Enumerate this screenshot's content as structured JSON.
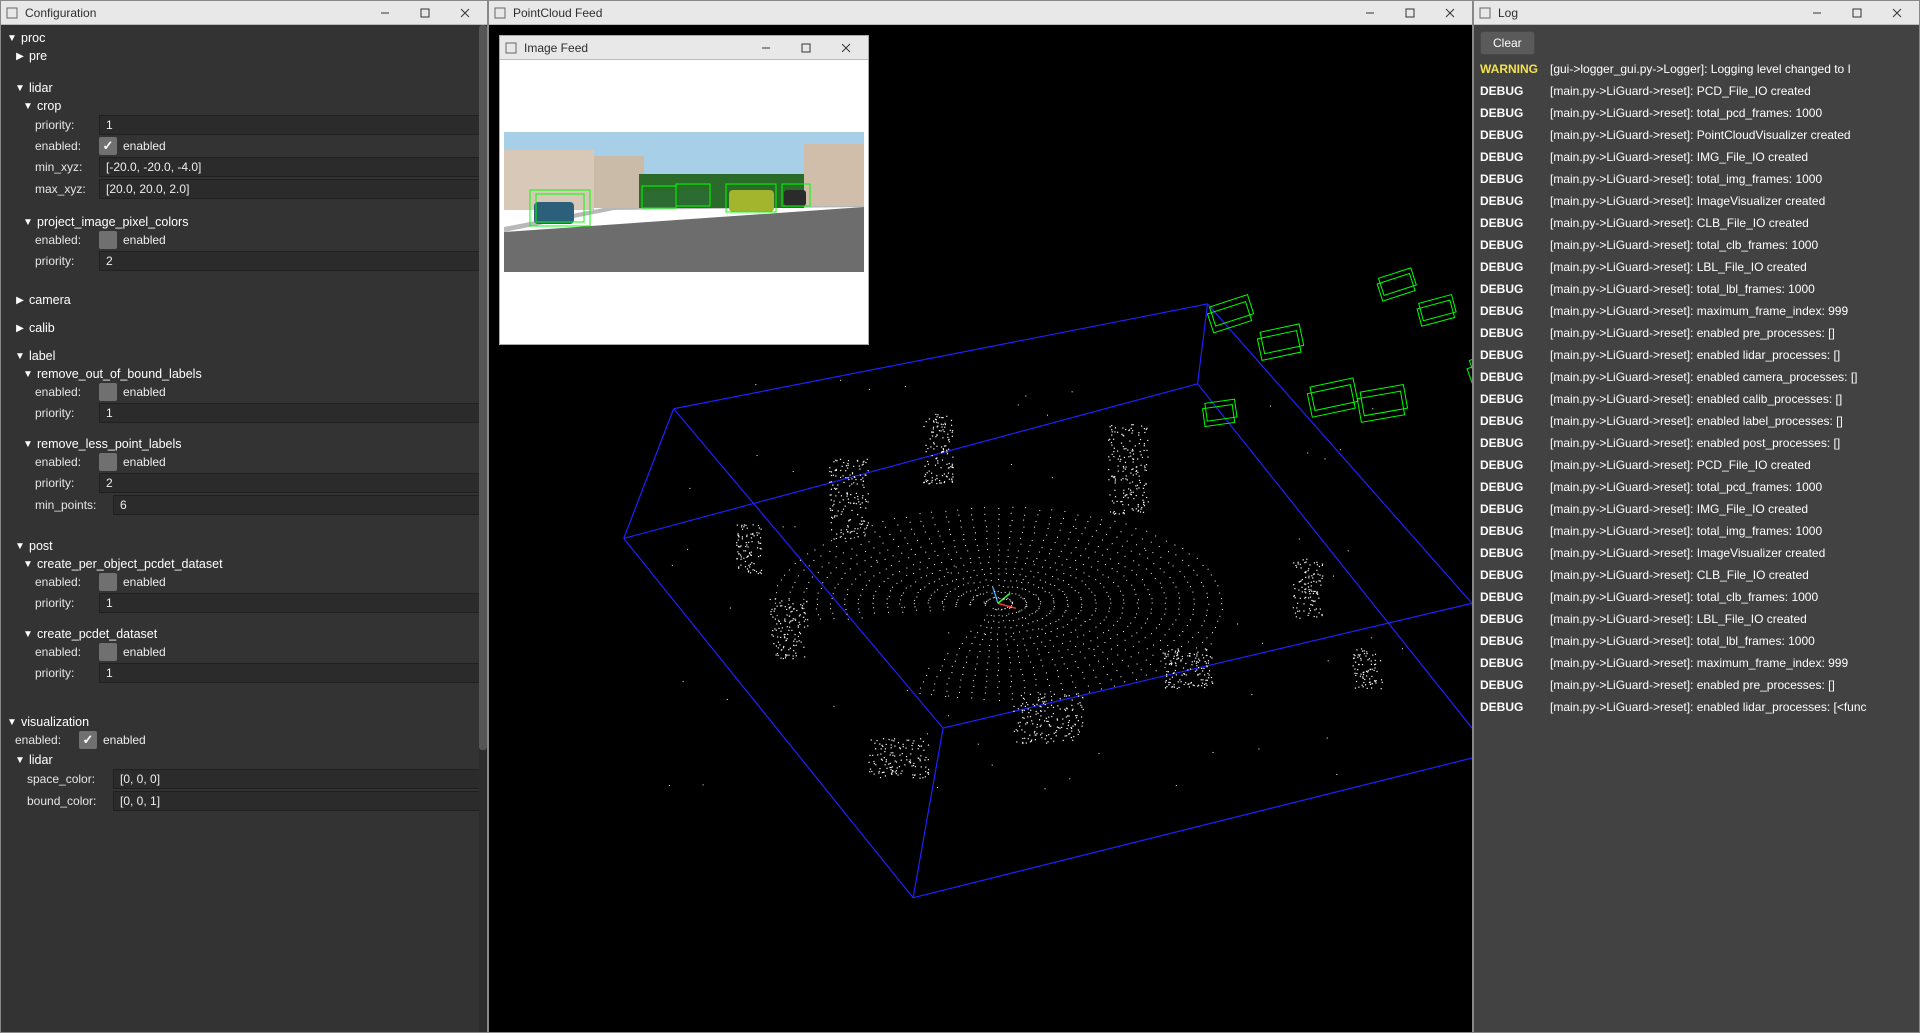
{
  "windows": {
    "config_title": "Configuration",
    "pcd_title": "PointCloud Feed",
    "log_title": "Log",
    "image_feed_title": "Image Feed"
  },
  "config": {
    "sections": {
      "proc": "proc",
      "pre": "pre",
      "lidar": "lidar",
      "crop": "crop",
      "project_image_pixel_colors": "project_image_pixel_colors",
      "camera": "camera",
      "calib": "calib",
      "label": "label",
      "remove_out_of_bound_labels": "remove_out_of_bound_labels",
      "remove_less_point_labels": "remove_less_point_labels",
      "post": "post",
      "create_per_object_pcdet_dataset": "create_per_object_pcdet_dataset",
      "create_pcdet_dataset": "create_pcdet_dataset",
      "visualization": "visualization",
      "viz_lidar": "lidar"
    },
    "labels": {
      "priority": "priority:",
      "enabled": "enabled:",
      "enabled_text": "enabled",
      "min_xyz": "min_xyz:",
      "max_xyz": "max_xyz:",
      "min_points": "min_points:",
      "space_color": "space_color:",
      "bound_color": "bound_color:"
    },
    "values": {
      "crop_priority": "1",
      "crop_enabled": true,
      "crop_min_xyz": "[-20.0, -20.0, -4.0]",
      "crop_max_xyz": "[20.0, 20.0, 2.0]",
      "pipc_enabled": false,
      "pipc_priority": "2",
      "rofb_enabled": false,
      "rofb_priority": "1",
      "rlpl_enabled": false,
      "rlpl_priority": "2",
      "rlpl_min_points": "6",
      "cpopd_enabled": false,
      "cpopd_priority": "1",
      "cpd_enabled": false,
      "cpd_priority": "1",
      "viz_enabled": true,
      "viz_space_color": "[0, 0, 0]",
      "viz_bound_color": "[0, 0, 1]"
    }
  },
  "log": {
    "clear_button": "Clear",
    "entries": [
      {
        "level": "WARNING",
        "msg": "[gui->logger_gui.py->Logger]: Logging level changed to I"
      },
      {
        "level": "DEBUG",
        "msg": "[main.py->LiGuard->reset]: PCD_File_IO created"
      },
      {
        "level": "DEBUG",
        "msg": "[main.py->LiGuard->reset]: total_pcd_frames: 1000"
      },
      {
        "level": "DEBUG",
        "msg": "[main.py->LiGuard->reset]: PointCloudVisualizer created"
      },
      {
        "level": "DEBUG",
        "msg": "[main.py->LiGuard->reset]: IMG_File_IO created"
      },
      {
        "level": "DEBUG",
        "msg": "[main.py->LiGuard->reset]: total_img_frames: 1000"
      },
      {
        "level": "DEBUG",
        "msg": "[main.py->LiGuard->reset]: ImageVisualizer created"
      },
      {
        "level": "DEBUG",
        "msg": "[main.py->LiGuard->reset]: CLB_File_IO created"
      },
      {
        "level": "DEBUG",
        "msg": "[main.py->LiGuard->reset]: total_clb_frames: 1000"
      },
      {
        "level": "DEBUG",
        "msg": "[main.py->LiGuard->reset]: LBL_File_IO created"
      },
      {
        "level": "DEBUG",
        "msg": "[main.py->LiGuard->reset]: total_lbl_frames: 1000"
      },
      {
        "level": "DEBUG",
        "msg": "[main.py->LiGuard->reset]: maximum_frame_index: 999"
      },
      {
        "level": "DEBUG",
        "msg": "[main.py->LiGuard->reset]: enabled pre_processes: []"
      },
      {
        "level": "DEBUG",
        "msg": "[main.py->LiGuard->reset]: enabled lidar_processes: []"
      },
      {
        "level": "DEBUG",
        "msg": "[main.py->LiGuard->reset]: enabled camera_processes: []"
      },
      {
        "level": "DEBUG",
        "msg": "[main.py->LiGuard->reset]: enabled calib_processes: []"
      },
      {
        "level": "DEBUG",
        "msg": "[main.py->LiGuard->reset]: enabled label_processes: []"
      },
      {
        "level": "DEBUG",
        "msg": "[main.py->LiGuard->reset]: enabled post_processes: []"
      },
      {
        "level": "DEBUG",
        "msg": "[main.py->LiGuard->reset]: PCD_File_IO created"
      },
      {
        "level": "DEBUG",
        "msg": "[main.py->LiGuard->reset]: total_pcd_frames: 1000"
      },
      {
        "level": "DEBUG",
        "msg": "[main.py->LiGuard->reset]: IMG_File_IO created"
      },
      {
        "level": "DEBUG",
        "msg": "[main.py->LiGuard->reset]: total_img_frames: 1000"
      },
      {
        "level": "DEBUG",
        "msg": "[main.py->LiGuard->reset]: ImageVisualizer created"
      },
      {
        "level": "DEBUG",
        "msg": "[main.py->LiGuard->reset]: CLB_File_IO created"
      },
      {
        "level": "DEBUG",
        "msg": "[main.py->LiGuard->reset]: total_clb_frames: 1000"
      },
      {
        "level": "DEBUG",
        "msg": "[main.py->LiGuard->reset]: LBL_File_IO created"
      },
      {
        "level": "DEBUG",
        "msg": "[main.py->LiGuard->reset]: total_lbl_frames: 1000"
      },
      {
        "level": "DEBUG",
        "msg": "[main.py->LiGuard->reset]: maximum_frame_index: 999"
      },
      {
        "level": "DEBUG",
        "msg": "[main.py->LiGuard->reset]: enabled pre_processes: []"
      },
      {
        "level": "DEBUG",
        "msg": "[main.py->LiGuard->reset]: enabled lidar_processes: [<func"
      }
    ]
  },
  "scene": {
    "bound_color": "#2020ff",
    "label_box_color": "#00ff00",
    "point_color": "#ffffff"
  }
}
